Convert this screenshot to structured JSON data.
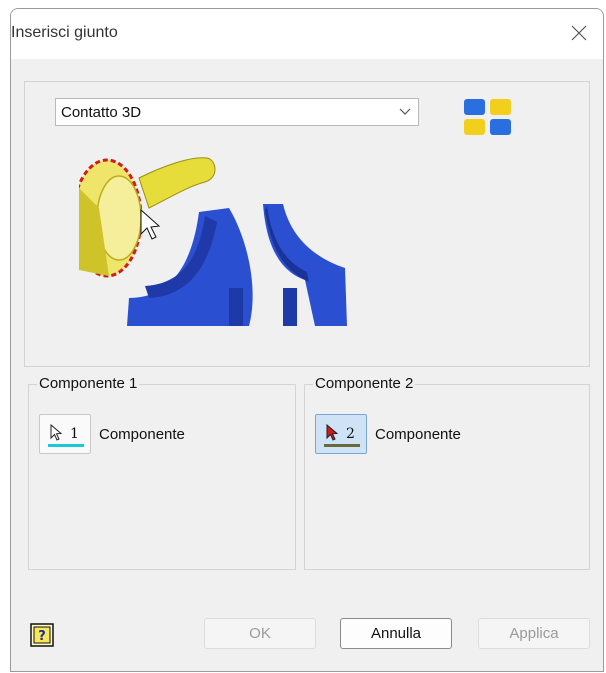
{
  "window": {
    "title": "Inserisci giunto"
  },
  "joint_type": {
    "selected": "Contatto 3D"
  },
  "preview": {
    "icon": "joint-preview-illustration",
    "colors": {
      "yellow_part": "#e8df3a",
      "blue_part": "#2b4fd1",
      "highlight": "#d11a1a"
    }
  },
  "layout_button": {
    "icon": "layout-grid-icon",
    "colors": {
      "blue": "#2a6fe0",
      "yellow": "#f1cf1c"
    }
  },
  "component1": {
    "label": "Componente 1",
    "number": "1",
    "text": "Componente",
    "underline_color": "#1cc7d6"
  },
  "component2": {
    "label": "Componente 2",
    "number": "2",
    "text": "Componente",
    "underline_color": "#6b6b3a",
    "active": true
  },
  "buttons": {
    "ok": "OK",
    "cancel": "Annulla",
    "apply": "Applica"
  },
  "help": {
    "icon": "help-icon"
  }
}
